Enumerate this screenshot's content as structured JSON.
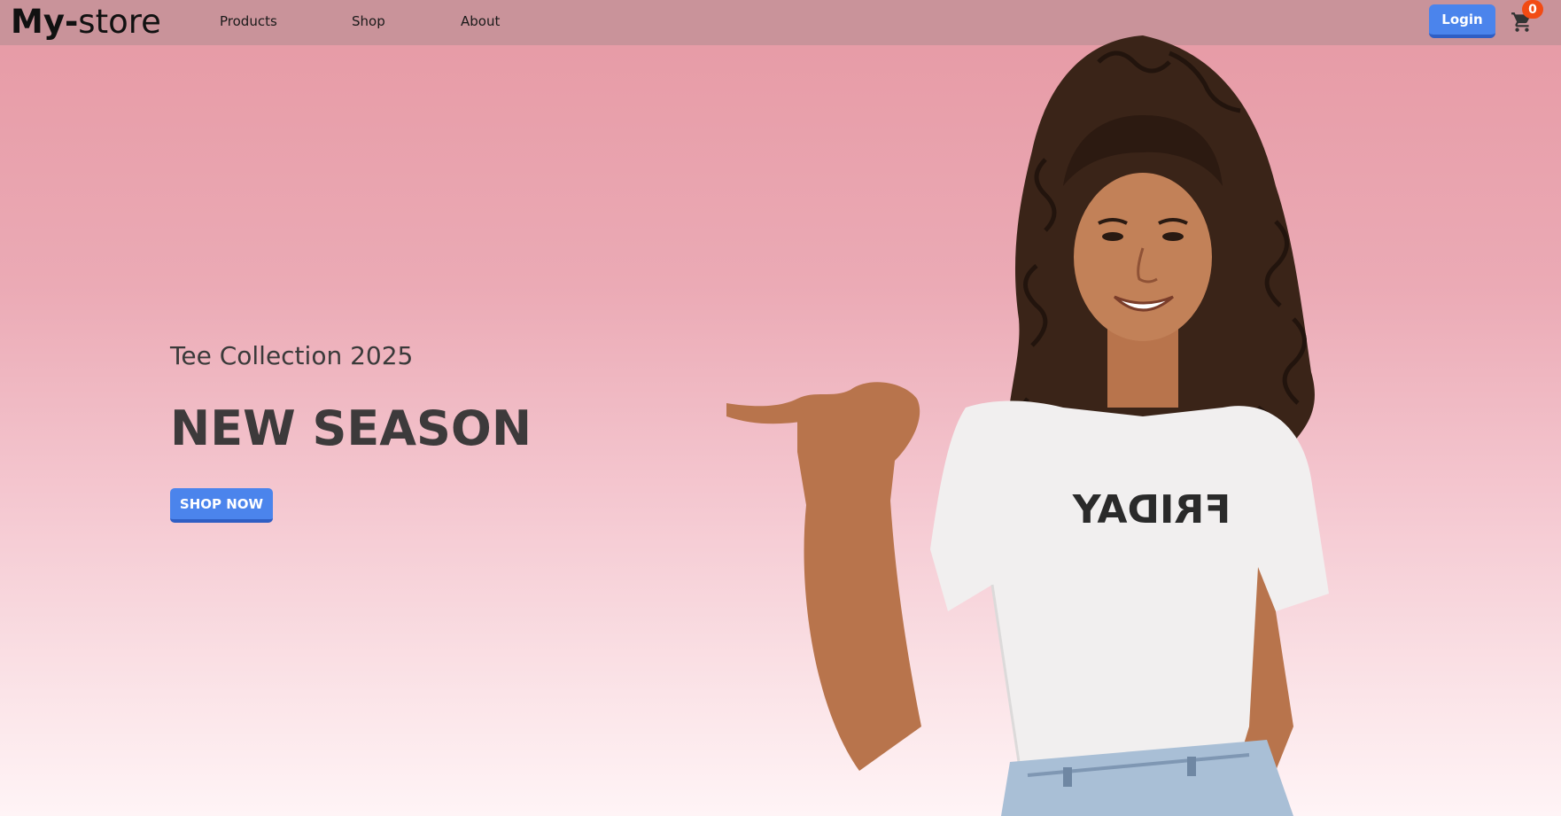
{
  "nav": {
    "logo_bold": "My-",
    "logo_rest": "store",
    "links": [
      "Products",
      "Shop",
      "About"
    ],
    "login_label": "Login",
    "cart_count": "0"
  },
  "hero": {
    "subtitle": "Tee Collection 2025",
    "headline": "NEW SEASON",
    "cta_label": "SHOP NOW",
    "shirt_text": "FRIDAY"
  },
  "colors": {
    "accent": "#4b84ec",
    "badge": "#f24b14",
    "navbar": "#c9939a"
  },
  "icons": {
    "cart": "cart-icon"
  }
}
